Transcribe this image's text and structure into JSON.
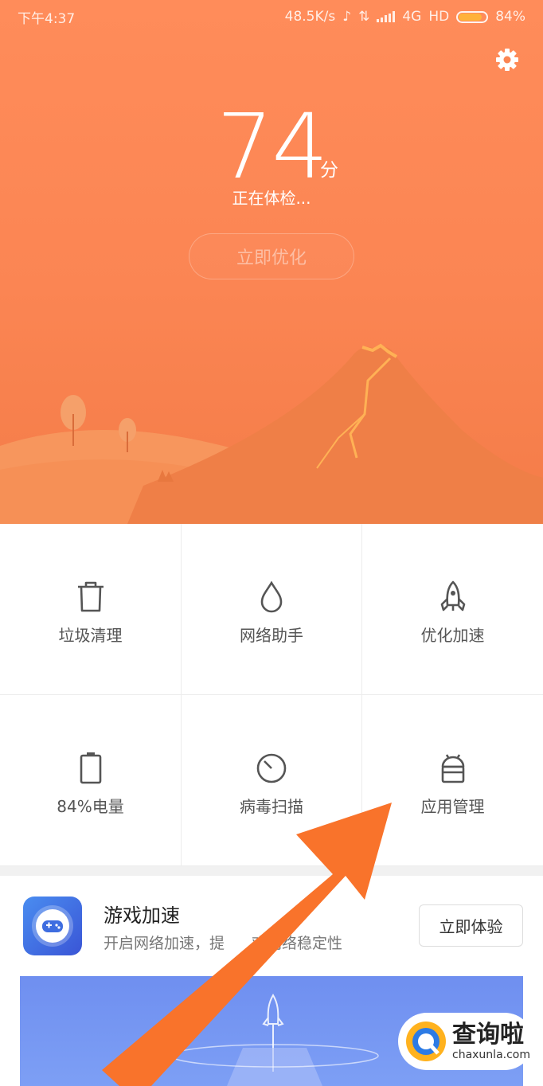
{
  "status_bar": {
    "time": "下午4:37",
    "net_speed": "48.5K/s",
    "network": "4G",
    "hd": "HD",
    "battery_text": "84%",
    "battery_level": 0.84
  },
  "header": {
    "settings_icon": "gear-icon",
    "score": "74",
    "score_unit": "分",
    "status": "正在体检...",
    "optimize_button": "立即优化"
  },
  "tools": [
    {
      "icon": "trash-icon",
      "label": "垃圾清理"
    },
    {
      "icon": "droplet-icon",
      "label": "网络助手"
    },
    {
      "icon": "rocket-icon",
      "label": "优化加速"
    },
    {
      "icon": "battery-icon",
      "label": "84%电量"
    },
    {
      "icon": "timer-icon",
      "label": "病毒扫描"
    },
    {
      "icon": "android-icon",
      "label": "应用管理"
    }
  ],
  "promo": {
    "icon": "gamepad-icon",
    "title": "游戏加速",
    "subtitle": "开启网络加速，提",
    "subtitle_tail": "戏网络稳定性",
    "button": "立即体验"
  },
  "watermark": {
    "cn": "查询啦",
    "en": "chaxunla.com"
  },
  "colors": {
    "hero": "#fb8553",
    "arrow": "#f9732b",
    "banner": "#7d9ff5"
  }
}
